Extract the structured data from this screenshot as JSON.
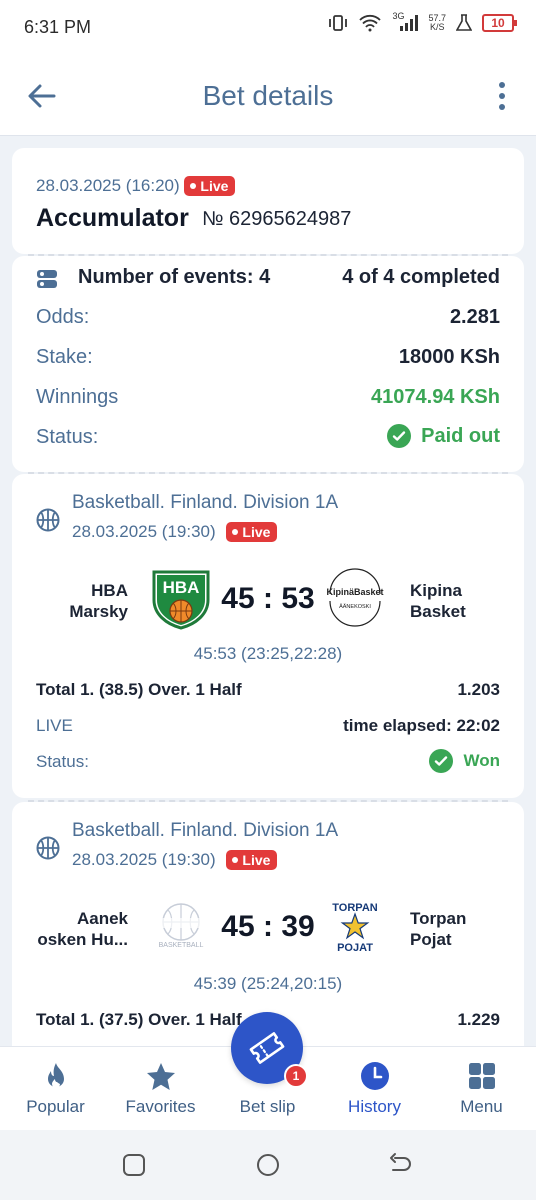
{
  "status_bar": {
    "time": "6:31 PM",
    "network": "3G",
    "speed_top": "57.7",
    "speed_unit": "K/S",
    "battery": "10"
  },
  "header": {
    "title": "Bet details"
  },
  "bet": {
    "datetime": "28.03.2025 (16:20)",
    "live_label": "Live",
    "type": "Accumulator",
    "number": "№ 62965624987"
  },
  "summary": {
    "events_label": "Number of events: 4",
    "completed": "4 of 4 completed",
    "odds_label": "Odds:",
    "odds_value": "2.281",
    "stake_label": "Stake:",
    "stake_value": "18000 KSh",
    "winnings_label": "Winnings",
    "winnings_value": "41074.94 KSh",
    "status_label": "Status:",
    "status_value": "Paid out"
  },
  "events": [
    {
      "league": "Basketball. Finland. Division 1A",
      "datetime": "28.03.2025 (19:30)",
      "live_label": "Live",
      "home_line1": "HBA",
      "home_line2": "Marsky",
      "home_logo_text": "HBA",
      "score": "45 : 53",
      "away_line1": "Kipina",
      "away_line2": "Basket",
      "away_logo_text": "KipinäBasket",
      "away_logo_sub": "ÄÄNEKOSKI",
      "sub_score": "45:53 (23:25,22:28)",
      "market": "Total 1. (38.5) Over. 1 Half",
      "market_odds": "1.203",
      "live_text": "LIVE",
      "time_elapsed": "time elapsed: 22:02",
      "status_label": "Status:",
      "status_value": "Won"
    },
    {
      "league": "Basketball. Finland. Division 1A",
      "datetime": "28.03.2025 (19:30)",
      "live_label": "Live",
      "home_line1": "Aanek",
      "home_line2": "osken Hu...",
      "home_logo_text": "BASKETBALL",
      "score": "45 : 39",
      "away_line1": "Torpan",
      "away_line2": "Pojat",
      "away_logo_top": "TORPAN",
      "away_logo_bottom": "POJAT",
      "sub_score": "45:39 (25:24,20:15)",
      "market": "Total 1. (37.5) Over. 1 Half",
      "market_odds": "1.229"
    }
  ],
  "bottom_nav": {
    "items": [
      {
        "label": "Popular",
        "icon": "flame-icon"
      },
      {
        "label": "Favorites",
        "icon": "star-icon"
      },
      {
        "label": "Bet slip",
        "icon": "ticket-icon",
        "badge": "1"
      },
      {
        "label": "History",
        "icon": "clock-icon"
      },
      {
        "label": "Menu",
        "icon": "grid-icon"
      }
    ]
  },
  "colors": {
    "accent": "#2d55c8",
    "label_blue": "#4d6f95",
    "green": "#3aa655",
    "live_red": "#e23a3a"
  }
}
